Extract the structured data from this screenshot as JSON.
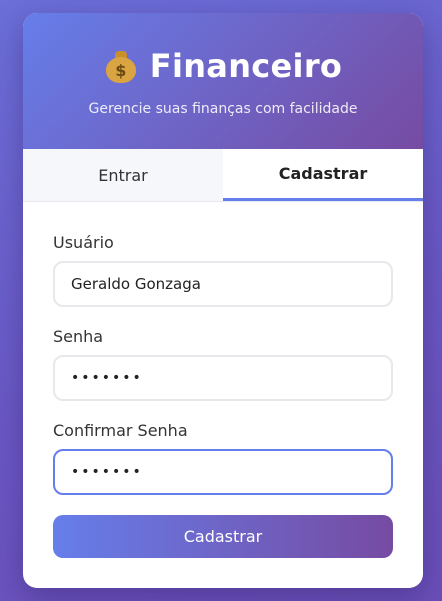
{
  "app": {
    "title": "Financeiro",
    "subtitle": "Gerencie suas finanças com facilidade",
    "icon": "money-bag-icon",
    "icon_sign": "$"
  },
  "tabs": [
    {
      "label": "Entrar",
      "active": false
    },
    {
      "label": "Cadastrar",
      "active": true
    }
  ],
  "form": {
    "username_label": "Usuário",
    "username_value": "Geraldo Gonzaga",
    "password_label": "Senha",
    "password_value": "•••••••",
    "confirm_label": "Confirmar Senha",
    "confirm_value": "•••••••",
    "submit_label": "Cadastrar"
  },
  "colors": {
    "accent_start": "#667eea",
    "accent_end": "#764ba2",
    "background": "#6a58c4"
  }
}
